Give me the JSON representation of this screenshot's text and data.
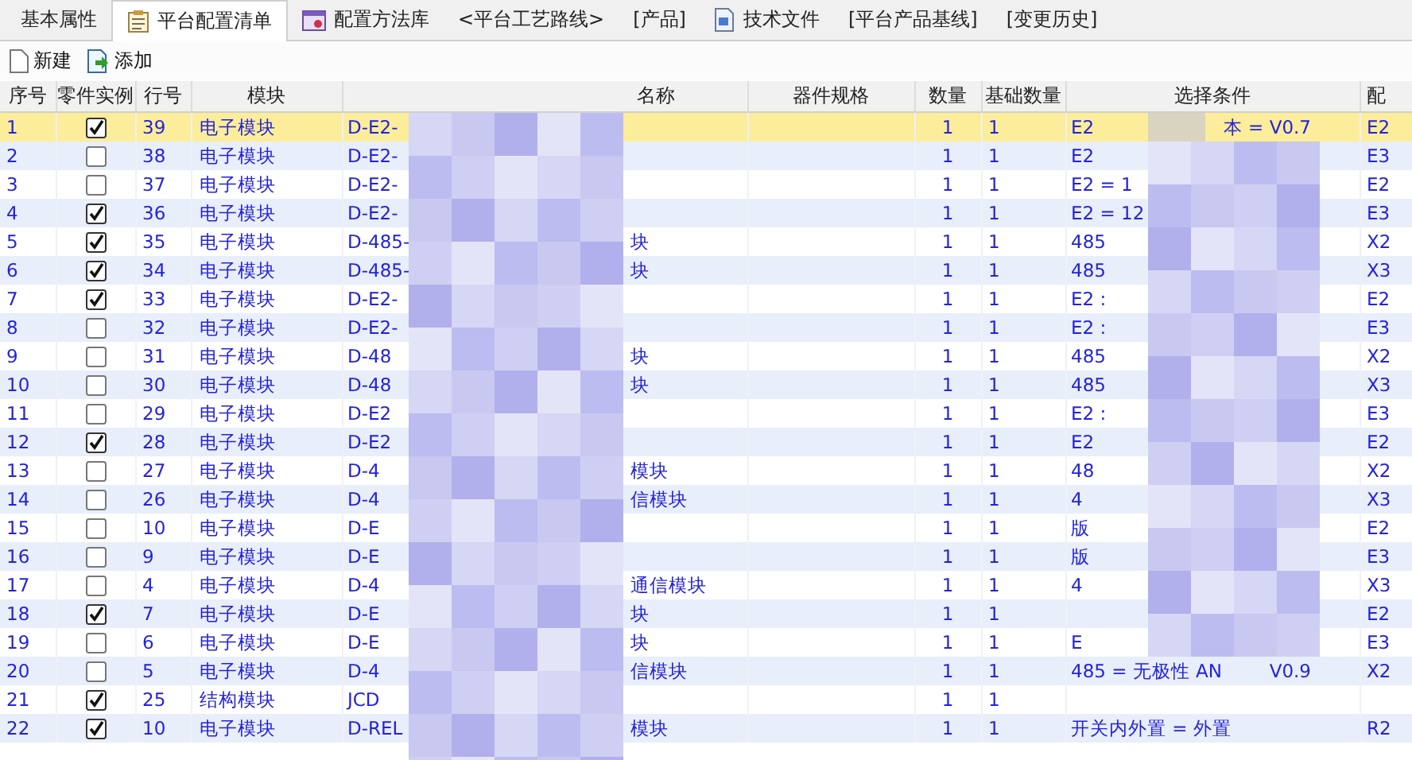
{
  "tabs": [
    {
      "label": "基本属性",
      "selected": false
    },
    {
      "label": "平台配置清单",
      "selected": true
    },
    {
      "label": "配置方法库",
      "selected": false
    },
    {
      "label": "<平台工艺路线>",
      "selected": false
    },
    {
      "label": "[产品]",
      "selected": false
    },
    {
      "label": "技术文件",
      "selected": false
    },
    {
      "label": "[平台产品基线]",
      "selected": false
    },
    {
      "label": "[变更历史]",
      "selected": false
    }
  ],
  "toolbar": [
    {
      "label": "新建",
      "kind": "new"
    },
    {
      "label": "添加",
      "kind": "add"
    }
  ],
  "table": {
    "columns": [
      "序号",
      "零件实例",
      "行号",
      "模块",
      "名称",
      "器件规格",
      "数量",
      "基础数量",
      "选择条件",
      "配"
    ],
    "rows": [
      {
        "no": "1",
        "instance": true,
        "line": "39",
        "module": "电子模块",
        "code": "D-E2-",
        "name": "",
        "qty": "1",
        "base": "1",
        "condition": "E2",
        "condition_tail": "本 = V0.7",
        "col_10": "E2",
        "selected": true
      },
      {
        "no": "2",
        "instance": false,
        "line": "38",
        "module": "电子模块",
        "code": "D-E2-",
        "name": "",
        "qty": "1",
        "base": "1",
        "condition": "E2",
        "condition_tail": "",
        "col_10": "E3",
        "selected": false
      },
      {
        "no": "3",
        "instance": false,
        "line": "37",
        "module": "电子模块",
        "code": "D-E2-",
        "name": "",
        "qty": "1",
        "base": "1",
        "condition": "E2 = 1",
        "condition_tail": "",
        "col_10": "E2",
        "selected": false
      },
      {
        "no": "4",
        "instance": true,
        "line": "36",
        "module": "电子模块",
        "code": "D-E2-",
        "name": "",
        "qty": "1",
        "base": "1",
        "condition": "E2 = 12",
        "condition_tail": "",
        "col_10": "E3",
        "selected": false
      },
      {
        "no": "5",
        "instance": true,
        "line": "35",
        "module": "电子模块",
        "code": "D-485-",
        "name": "块",
        "qty": "1",
        "base": "1",
        "condition": "485",
        "condition_tail": "",
        "col_10": "X2",
        "selected": false
      },
      {
        "no": "6",
        "instance": true,
        "line": "34",
        "module": "电子模块",
        "code": "D-485-",
        "name": "块",
        "qty": "1",
        "base": "1",
        "condition": "485",
        "condition_tail": "",
        "col_10": "X3",
        "selected": false
      },
      {
        "no": "7",
        "instance": true,
        "line": "33",
        "module": "电子模块",
        "code": "D-E2-",
        "name": "",
        "qty": "1",
        "base": "1",
        "condition": "E2 :",
        "condition_tail": "",
        "col_10": "E2",
        "selected": false
      },
      {
        "no": "8",
        "instance": false,
        "line": "32",
        "module": "电子模块",
        "code": "D-E2-",
        "name": "",
        "qty": "1",
        "base": "1",
        "condition": "E2 :",
        "condition_tail": "",
        "col_10": "E3",
        "selected": false
      },
      {
        "no": "9",
        "instance": false,
        "line": "31",
        "module": "电子模块",
        "code": "D-48",
        "name": "块",
        "qty": "1",
        "base": "1",
        "condition": "485",
        "condition_tail": "",
        "col_10": "X2",
        "selected": false
      },
      {
        "no": "10",
        "instance": false,
        "line": "30",
        "module": "电子模块",
        "code": "D-48",
        "name": "块",
        "qty": "1",
        "base": "1",
        "condition": "485",
        "condition_tail": "",
        "col_10": "X3",
        "selected": false
      },
      {
        "no": "11",
        "instance": false,
        "line": "29",
        "module": "电子模块",
        "code": "D-E2",
        "name": "",
        "qty": "1",
        "base": "1",
        "condition": "E2 :",
        "condition_tail": "",
        "col_10": "E3",
        "selected": false
      },
      {
        "no": "12",
        "instance": true,
        "line": "28",
        "module": "电子模块",
        "code": "D-E2",
        "name": "",
        "qty": "1",
        "base": "1",
        "condition": "E2",
        "condition_tail": "",
        "col_10": "E2",
        "selected": false
      },
      {
        "no": "13",
        "instance": false,
        "line": "27",
        "module": "电子模块",
        "code": "D-4",
        "name": "模块",
        "qty": "1",
        "base": "1",
        "condition": "48",
        "condition_tail": "",
        "col_10": "X2",
        "selected": false
      },
      {
        "no": "14",
        "instance": false,
        "line": "26",
        "module": "电子模块",
        "code": "D-4",
        "name": "信模块",
        "qty": "1",
        "base": "1",
        "condition": "4",
        "condition_tail": "",
        "col_10": "X3",
        "selected": false
      },
      {
        "no": "15",
        "instance": false,
        "line": "10",
        "module": "电子模块",
        "code": "D-E",
        "name": "",
        "qty": "1",
        "base": "1",
        "condition": "版",
        "condition_tail": "",
        "col_10": "E2",
        "selected": false
      },
      {
        "no": "16",
        "instance": false,
        "line": "9",
        "module": "电子模块",
        "code": "D-E",
        "name": "",
        "qty": "1",
        "base": "1",
        "condition": "版",
        "condition_tail": "",
        "col_10": "E3",
        "selected": false
      },
      {
        "no": "17",
        "instance": false,
        "line": "4",
        "module": "电子模块",
        "code": "D-4",
        "name": "通信模块",
        "qty": "1",
        "base": "1",
        "condition": "4",
        "condition_tail": "",
        "col_10": "X3",
        "selected": false
      },
      {
        "no": "18",
        "instance": true,
        "line": "7",
        "module": "电子模块",
        "code": "D-E",
        "name": "块",
        "qty": "1",
        "base": "1",
        "condition": "",
        "condition_tail": "",
        "col_10": "E2",
        "selected": false
      },
      {
        "no": "19",
        "instance": false,
        "line": "6",
        "module": "电子模块",
        "code": "D-E",
        "name": "块",
        "qty": "1",
        "base": "1",
        "condition": "E",
        "condition_tail": "",
        "col_10": "E3",
        "selected": false
      },
      {
        "no": "20",
        "instance": false,
        "line": "5",
        "module": "电子模块",
        "code": "D-4",
        "name": "信模块",
        "qty": "1",
        "base": "1",
        "condition": "485 = 无极性 AN",
        "condition_tail": "V0.9",
        "col_10": "X2",
        "selected": false
      },
      {
        "no": "21",
        "instance": true,
        "line": "25",
        "module": "结构模块",
        "code": "JCD",
        "name": "",
        "qty": "1",
        "base": "1",
        "condition": "",
        "condition_tail": "",
        "col_10": "",
        "selected": false
      },
      {
        "no": "22",
        "instance": true,
        "line": "10",
        "module": "电子模块",
        "code": "D-REL",
        "name": "模块",
        "qty": "1",
        "base": "1",
        "condition": "开关内外置 = 外置",
        "condition_tail": "",
        "col_10": "R2",
        "selected": false
      }
    ]
  }
}
